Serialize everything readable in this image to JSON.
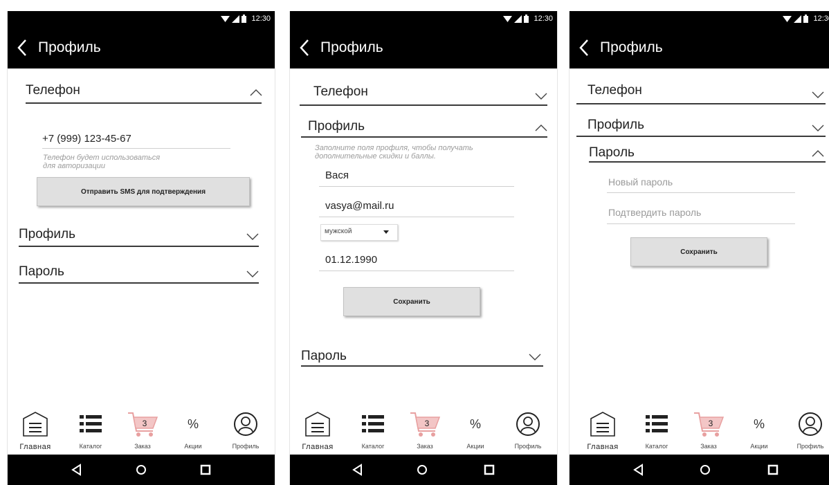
{
  "status": {
    "time": "12:30"
  },
  "appbar": {
    "title": "Профиль"
  },
  "screens": [
    {
      "sections": {
        "phone": "Телефон",
        "profile": "Профиль",
        "password": "Пароль"
      },
      "phone_value": "+7 (999) 123-45-67",
      "phone_hint": [
        "Телефон будет использоваться",
        "для авторизации"
      ],
      "sms_button": "Отправить SMS для подтверждения"
    },
    {
      "sections": {
        "phone": "Телефон",
        "profile": "Профиль",
        "password": "Пароль"
      },
      "profile_hint": [
        "Заполните поля профиля, чтобы получать",
        "дополнительные  скидки и баллы."
      ],
      "name_value": "Вася",
      "email_value": "vasya@mail.ru",
      "gender_value": "мужской",
      "birthdate_value": "01.12.1990",
      "save_button": "Сохранить"
    },
    {
      "sections": {
        "phone": "Телефон",
        "profile": "Профиль",
        "password": "Пароль"
      },
      "new_password_placeholder": "Новый пароль",
      "confirm_password_placeholder": "Подтвердить пароль",
      "save_button": "Сохранить"
    }
  ],
  "bottom_nav": {
    "items": [
      {
        "label": "Главная",
        "icon": "home-menu-icon"
      },
      {
        "label": "Каталог",
        "icon": "catalog-list-icon"
      },
      {
        "label": "Заказ",
        "icon": "cart-icon",
        "badge": "3"
      },
      {
        "label": "Акции",
        "icon": "percent-icon",
        "glyph": "%"
      },
      {
        "label": "Профиль",
        "icon": "profile-user-icon"
      }
    ]
  },
  "colors": {
    "bar": "#000000",
    "cart_accent": "#e8a0a0",
    "button_bg": "#e0e0e0"
  }
}
